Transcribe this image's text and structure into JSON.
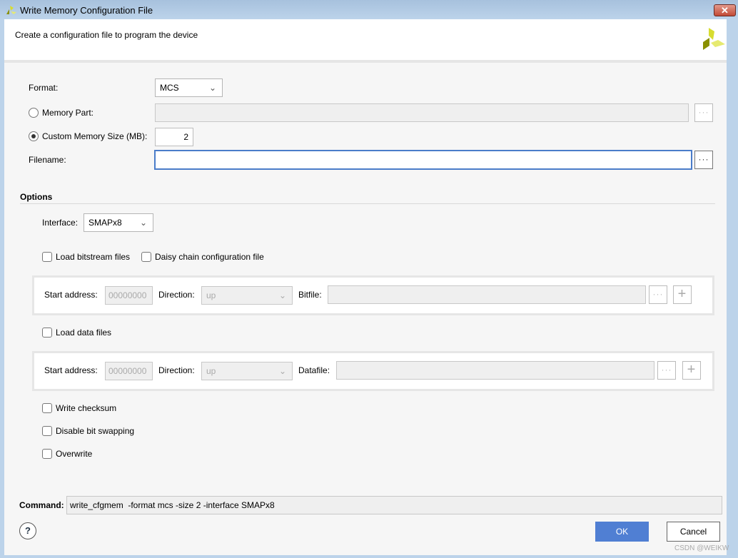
{
  "window": {
    "title": "Write Memory Configuration File",
    "close_icon": "close-icon"
  },
  "header": {
    "subtitle": "Create a configuration file to program the device",
    "logo": "xilinx-logo"
  },
  "form": {
    "format_label": "Format:",
    "format_value": "MCS",
    "memory_part_label": "Memory Part:",
    "memory_part_value": "",
    "memory_part_selected": false,
    "custom_size_label": "Custom Memory Size (MB):",
    "custom_size_value": "2",
    "custom_size_selected": true,
    "filename_label": "Filename:",
    "filename_value": "",
    "browse_label": "···"
  },
  "options": {
    "heading": "Options",
    "interface_label": "Interface:",
    "interface_value": "SMAPx8",
    "load_bitstream_label": "Load bitstream files",
    "load_bitstream_checked": false,
    "daisy_chain_label": "Daisy chain configuration file",
    "daisy_chain_checked": false,
    "bit_panel": {
      "start_label": "Start address:",
      "start_value": "00000000",
      "direction_label": "Direction:",
      "direction_value": "up",
      "file_label": "Bitfile:",
      "file_value": ""
    },
    "load_data_label": "Load data files",
    "load_data_checked": false,
    "data_panel": {
      "start_label": "Start address:",
      "start_value": "00000000",
      "direction_label": "Direction:",
      "direction_value": "up",
      "file_label": "Datafile:",
      "file_value": ""
    },
    "write_checksum_label": "Write checksum",
    "write_checksum_checked": false,
    "disable_swap_label": "Disable bit swapping",
    "disable_swap_checked": false,
    "overwrite_label": "Overwrite",
    "overwrite_checked": false
  },
  "command": {
    "label": "Command:",
    "value": "write_cfgmem  -format mcs -size 2 -interface SMAPx8"
  },
  "footer": {
    "help": "?",
    "ok": "OK",
    "cancel": "Cancel",
    "watermark": "CSDN @WEIKW"
  },
  "colors": {
    "accent": "#507fd3",
    "focus_border": "#4a7cc9"
  }
}
